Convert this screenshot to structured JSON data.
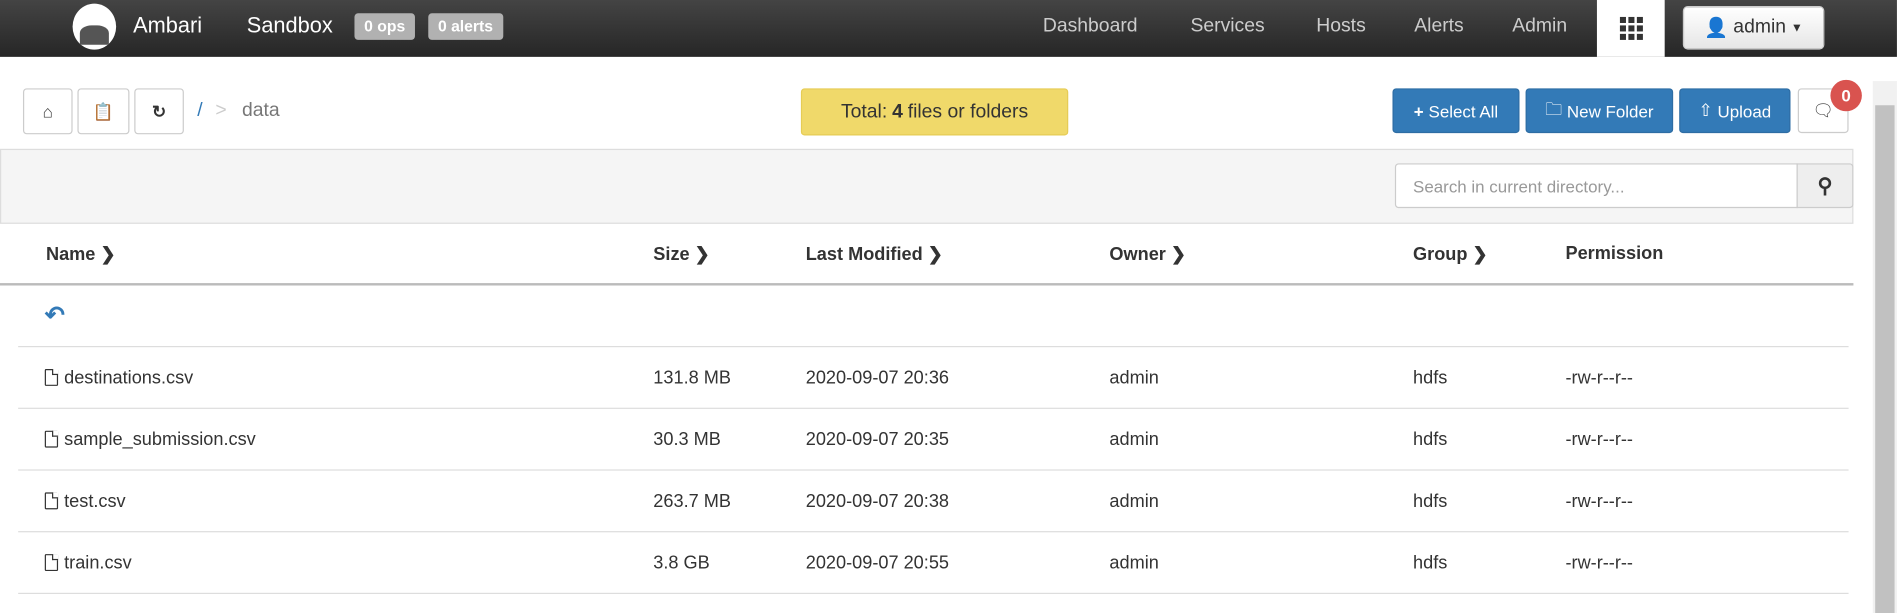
{
  "navbar": {
    "brand": "Ambari",
    "cluster": "Sandbox",
    "ops_badge": "0 ops",
    "alerts_badge": "0 alerts",
    "items": [
      "Dashboard",
      "Services",
      "Hosts",
      "Alerts",
      "Admin"
    ],
    "user": "admin"
  },
  "toolbar": {
    "root": "/",
    "separator": ">",
    "current": "data",
    "total_prefix": "Total:",
    "total_count": "4",
    "total_suffix": "files or folders",
    "select_all": "Select All",
    "new_folder": "New Folder",
    "upload": "Upload",
    "notification_count": "0"
  },
  "search": {
    "placeholder": "Search in current directory..."
  },
  "table": {
    "headers": [
      "Name",
      "Size",
      "Last Modified",
      "Owner",
      "Group",
      "Permission"
    ],
    "rows": [
      {
        "name": "destinations.csv",
        "size": "131.8 MB",
        "modified": "2020-09-07 20:36",
        "owner": "admin",
        "group": "hdfs",
        "permission": "-rw-r--r--"
      },
      {
        "name": "sample_submission.csv",
        "size": "30.3 MB",
        "modified": "2020-09-07 20:35",
        "owner": "admin",
        "group": "hdfs",
        "permission": "-rw-r--r--"
      },
      {
        "name": "test.csv",
        "size": "263.7 MB",
        "modified": "2020-09-07 20:38",
        "owner": "admin",
        "group": "hdfs",
        "permission": "-rw-r--r--"
      },
      {
        "name": "train.csv",
        "size": "3.8 GB",
        "modified": "2020-09-07 20:55",
        "owner": "admin",
        "group": "hdfs",
        "permission": "-rw-r--r--"
      }
    ]
  }
}
